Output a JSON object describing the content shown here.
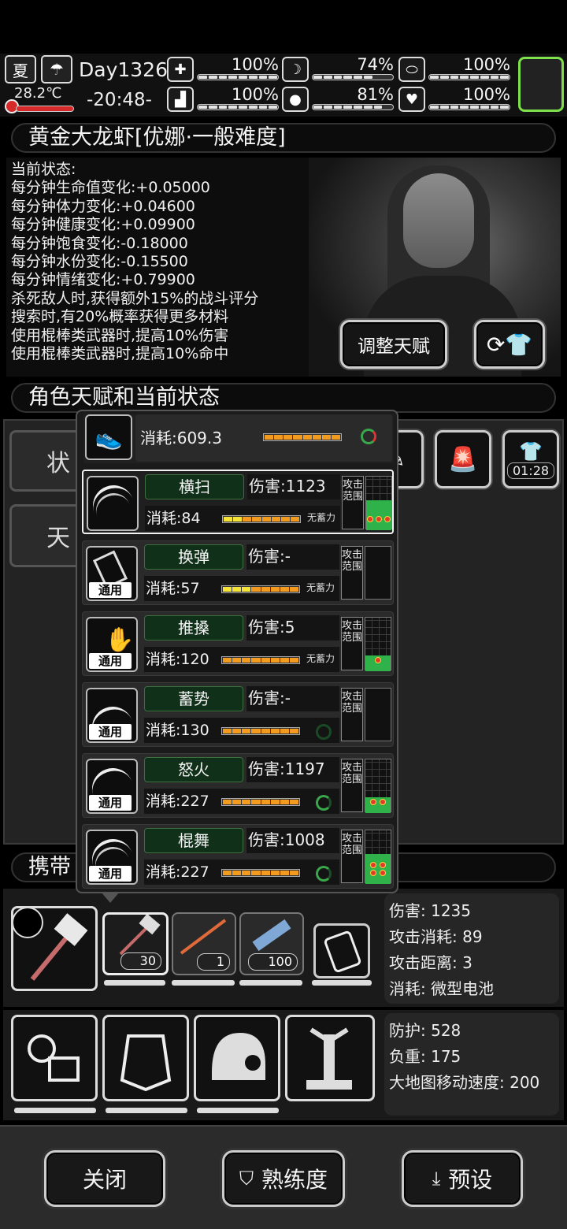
{
  "status": {
    "season": "夏",
    "weather_icon": "cloud-rain-icon",
    "temperature": "28.2℃",
    "day": "Day1326",
    "time": "-20:48-",
    "bars": [
      {
        "icon": "medkit-icon",
        "glyph": "✚",
        "pct": "100%",
        "level": 1.0
      },
      {
        "icon": "stomach-icon",
        "glyph": "☽",
        "pct": "74%",
        "level": 0.74
      },
      {
        "icon": "capsule-icon",
        "glyph": "⬭",
        "pct": "100%",
        "level": 1.0
      },
      {
        "icon": "boot-icon",
        "glyph": "▟",
        "pct": "100%",
        "level": 1.0
      },
      {
        "icon": "water-drop-icon",
        "glyph": "💧",
        "pct": "81%",
        "level": 0.81
      },
      {
        "icon": "heart-icon",
        "glyph": "♥",
        "pct": "100%",
        "level": 1.0
      }
    ],
    "accent": "#7ee04a"
  },
  "character": {
    "title": "黄金大龙虾[优娜·一般难度]",
    "lines": [
      "当前状态:",
      "每分钟生命值变化:+0.05000",
      "每分钟体力变化:+0.04600",
      "每分钟健康变化:+0.09900",
      "每分钟饱食变化:-0.18000",
      "每分钟水份变化:-0.15500",
      "每分钟情绪变化:+0.79900",
      "杀死敌人时,获得额外15%的战斗评分",
      "搜索时,有20%概率获得更多材料",
      "使用棍棒类武器时,提高10%伤害",
      "使用棍棒类武器时,提高10%命中"
    ],
    "adjust_talent": "调整天赋"
  },
  "talents": {
    "title": "角色天赋和当前状态",
    "btn1": "状",
    "btn2": "天",
    "timer": "01:28"
  },
  "popup": {
    "header_cost": "消耗:609.3",
    "range_label": "攻击范围",
    "skills": [
      {
        "name": "横扫",
        "damage": "伤害:1123",
        "cost": "消耗:84",
        "note": "无蓄力",
        "tag": ""
      },
      {
        "name": "换弹",
        "damage": "伤害:-",
        "cost": "消耗:57",
        "note": "无蓄力",
        "tag": "通用"
      },
      {
        "name": "推搡",
        "damage": "伤害:5",
        "cost": "消耗:120",
        "note": "无蓄力",
        "tag": "通用"
      },
      {
        "name": "蓄势",
        "damage": "伤害:-",
        "cost": "消耗:130",
        "note": "",
        "tag": "通用"
      },
      {
        "name": "怒火",
        "damage": "伤害:1197",
        "cost": "消耗:227",
        "note": "",
        "tag": "通用"
      },
      {
        "name": "棍舞",
        "damage": "伤害:1008",
        "cost": "消耗:227",
        "note": "",
        "tag": "通用"
      }
    ]
  },
  "carry": {
    "title": "携带",
    "weapons": [
      {
        "count": "30"
      },
      {
        "count": "1"
      },
      {
        "count": "100"
      }
    ],
    "weapon_info": [
      "伤害: 1235",
      "攻击消耗: 89",
      "攻击距离: 3",
      "消耗: 微型电池"
    ],
    "armor_info": [
      "防护: 528",
      "负重: 175",
      "大地图移动速度: 200"
    ]
  },
  "bottom": {
    "close": "关闭",
    "proficiency": "熟练度",
    "preset": "预设"
  }
}
